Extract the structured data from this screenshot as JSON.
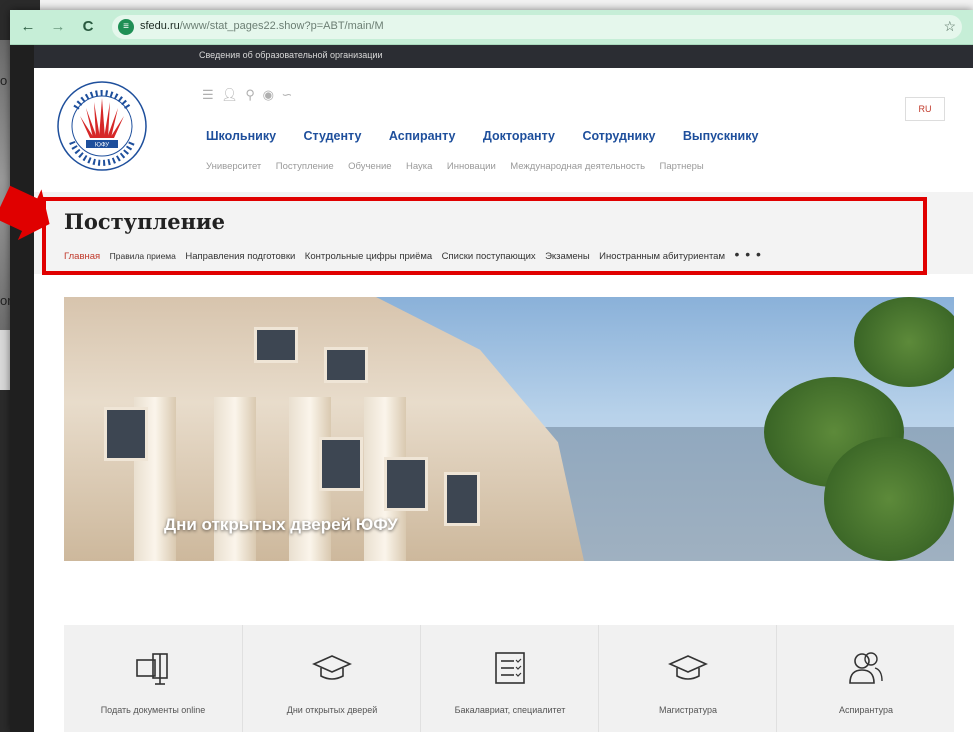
{
  "browser": {
    "url_domain": "sfedu.ru",
    "url_path": "/www/stat_pages22.show?p=ABT/main/M",
    "back_icon": "arrow-left-icon",
    "forward_icon": "arrow-right-icon",
    "reload_icon": "reload-icon",
    "star_icon": "star-icon"
  },
  "bg_window": {
    "text_1": "o",
    "text_2": "or"
  },
  "site": {
    "infobar_text": "Сведения об образовательной организации",
    "lang_button": "RU",
    "main_nav": [
      "Школьнику",
      "Студенту",
      "Аспиранту",
      "Докторанту",
      "Сотруднику",
      "Выпускнику"
    ],
    "sub_nav": [
      "Университет",
      "Поступление",
      "Обучение",
      "Наука",
      "Инновации",
      "Международная деятельность",
      "Партнеры"
    ],
    "page_title": "Поступление",
    "breadcrumb": {
      "home": "Главная",
      "items": [
        "Правила приема",
        "Направления подготовки",
        "Контрольные цифры приёма",
        "Списки поступающих",
        "Экзамены",
        "Иностранным абитуриентам"
      ],
      "more": "• • •"
    },
    "banner_text": "Дни открытых дверей ЮФУ",
    "quick_links": [
      {
        "label": "Подать документы online",
        "icon": "online-docs-icon"
      },
      {
        "label": "Дни открытых дверей",
        "icon": "graduation-cap-icon"
      },
      {
        "label": "Бакалавриат, специалитет",
        "icon": "checklist-icon"
      },
      {
        "label": "Магистратура",
        "icon": "graduation-cap-icon"
      },
      {
        "label": "Аспирантура",
        "icon": "users-icon"
      }
    ]
  },
  "colors": {
    "toolbar": "#c6eed7",
    "nav_blue": "#1e4f9c",
    "highlight_red": "#e00000",
    "home_red": "#c0392b"
  }
}
